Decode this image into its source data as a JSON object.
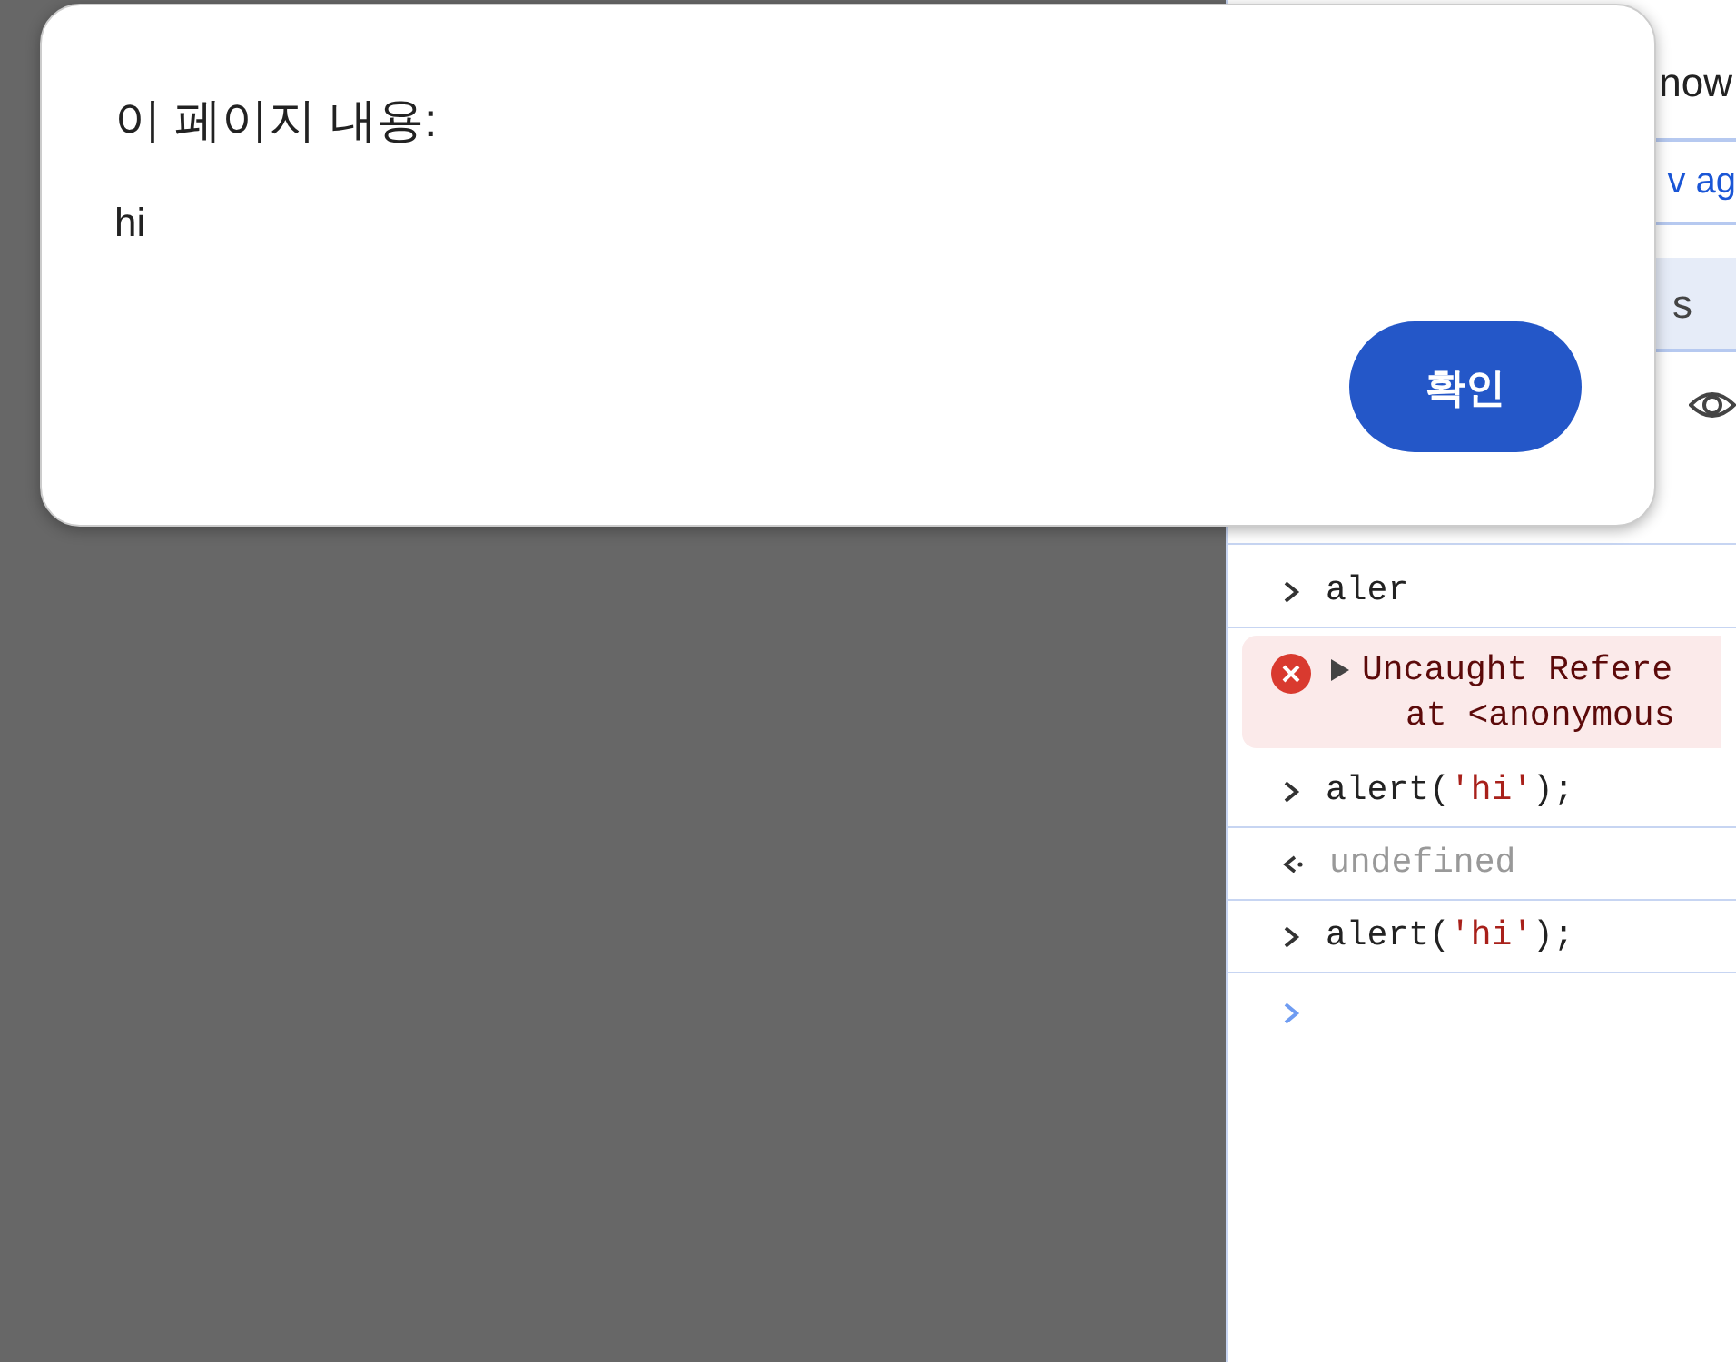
{
  "dialog": {
    "title": "이 페이지 내용:",
    "message": "hi",
    "button": "확인"
  },
  "devtools": {
    "top_text": "now",
    "link": "v ag",
    "tab": "s",
    "console": [
      {
        "kind": "input",
        "tokens": [
          {
            "kind": "plain",
            "text": "aler"
          }
        ]
      },
      {
        "kind": "error",
        "lines": [
          "Uncaught Refere",
          "at <anonymous"
        ]
      },
      {
        "kind": "input",
        "tokens": [
          {
            "kind": "plain",
            "text": "alert("
          },
          {
            "kind": "string",
            "text": "'hi'"
          },
          {
            "kind": "plain",
            "text": ");"
          }
        ]
      },
      {
        "kind": "output",
        "text": "undefined"
      },
      {
        "kind": "input",
        "tokens": [
          {
            "kind": "plain",
            "text": "alert("
          },
          {
            "kind": "string",
            "text": "'hi'"
          },
          {
            "kind": "plain",
            "text": ");"
          }
        ]
      },
      {
        "kind": "prompt"
      }
    ]
  }
}
